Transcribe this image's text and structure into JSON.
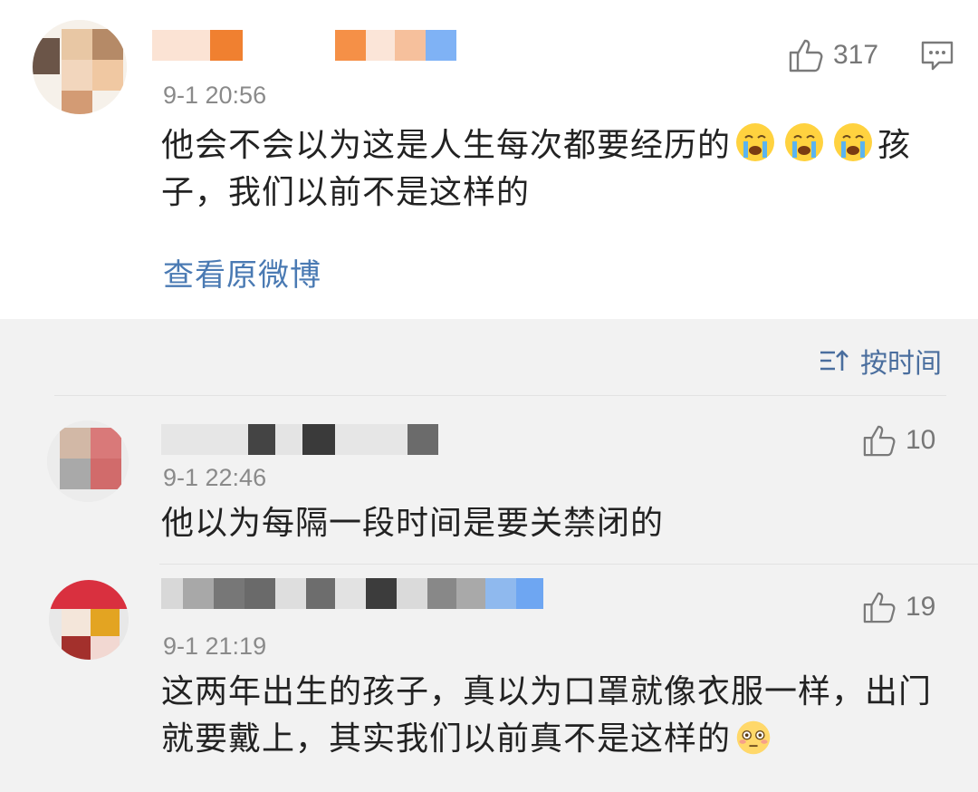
{
  "post": {
    "timestamp": "9-1 20:56",
    "likes": "317",
    "text_line1": "他会不会以为这是人生每次都要经历的",
    "text_line1_end": "孩",
    "text_line2": "子，我们以前不是这样的",
    "emoji": "crying-face-icon",
    "view_original_label": "查看原微博"
  },
  "sort": {
    "label": "按时间",
    "icon": "sort-icon"
  },
  "comments": [
    {
      "timestamp": "9-1 22:46",
      "likes": "10",
      "text": "他以为每隔一段时间是要关禁闭的"
    },
    {
      "timestamp": "9-1 21:19",
      "likes": "19",
      "text_line1": "这两年出生的孩子，真以为口罩就像衣服一样，出门",
      "text_line2": "就要戴上，其实我们以前真不是这样的",
      "emoji": "flushed-face-icon"
    }
  ],
  "colors": {
    "link": "#4a7ab3",
    "sort": "#4a6e9e",
    "timestamp": "#8a8a8a",
    "like": "#777777"
  }
}
